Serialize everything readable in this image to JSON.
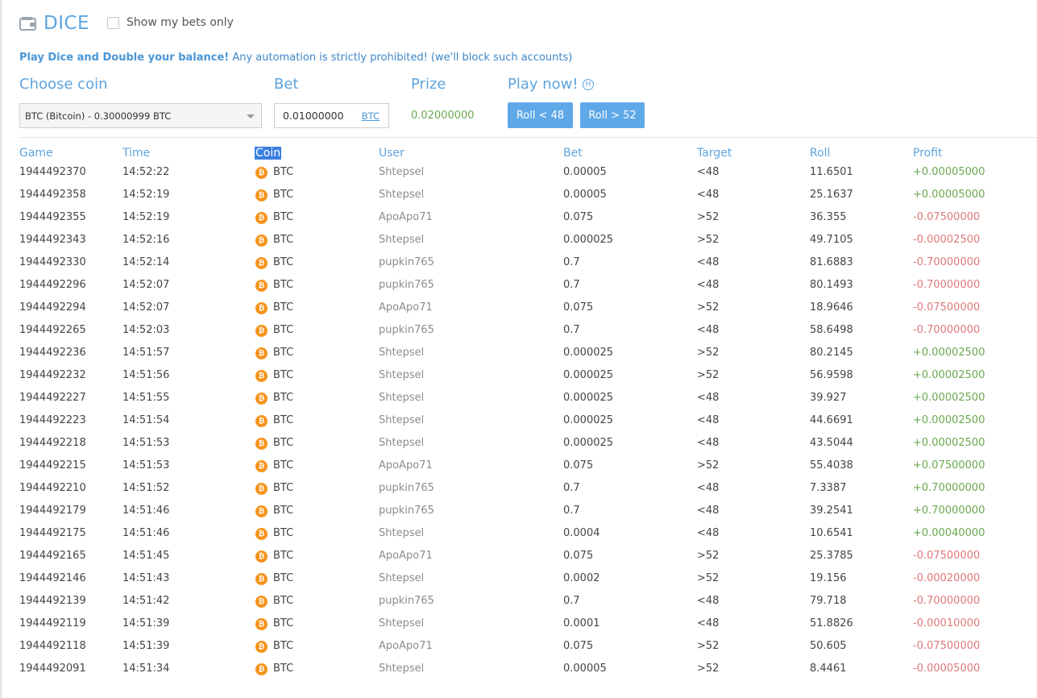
{
  "header": {
    "title": "DICE",
    "show_my_bets_label": "Show my bets only"
  },
  "promo": {
    "highlight": "Play Dice and Double your balance!",
    "rest": "Any automation is strictly prohibited! (we'll block such accounts)"
  },
  "controls": {
    "choose_coin_label": "Choose coin",
    "coin_selected": "BTC (Bitcoin) - 0.30000999 BTC",
    "bet_label": "Bet",
    "bet_value": "0.01000000",
    "bet_unit": "BTC",
    "prize_label": "Prize",
    "prize_value": "0.02000000",
    "play_label": "Play now!",
    "help_glyph": "H",
    "roll_low_label": "Roll < 48",
    "roll_high_label": "Roll > 52"
  },
  "colors": {
    "accent": "#5ea4de",
    "button": "#5fa8e8",
    "profit_positive": "#6aa84f",
    "profit_negative": "#e0787a",
    "coin": "#f7931a"
  },
  "table": {
    "columns": [
      "Game",
      "Time",
      "Coin",
      "User",
      "Bet",
      "Target",
      "Roll",
      "Profit"
    ],
    "rows": [
      {
        "game": "1944492370",
        "time": "14:52:22",
        "coin": "BTC",
        "user": "Shtepsel",
        "bet": "0.00005",
        "target": "<48",
        "roll": "11.6501",
        "profit": "+0.00005000"
      },
      {
        "game": "1944492358",
        "time": "14:52:19",
        "coin": "BTC",
        "user": "Shtepsel",
        "bet": "0.00005",
        "target": "<48",
        "roll": "25.1637",
        "profit": "+0.00005000"
      },
      {
        "game": "1944492355",
        "time": "14:52:19",
        "coin": "BTC",
        "user": "ApoApo71",
        "bet": "0.075",
        "target": ">52",
        "roll": "36.355",
        "profit": "-0.07500000"
      },
      {
        "game": "1944492343",
        "time": "14:52:16",
        "coin": "BTC",
        "user": "Shtepsel",
        "bet": "0.000025",
        "target": ">52",
        "roll": "49.7105",
        "profit": "-0.00002500"
      },
      {
        "game": "1944492330",
        "time": "14:52:14",
        "coin": "BTC",
        "user": "pupkin765",
        "bet": "0.7",
        "target": "<48",
        "roll": "81.6883",
        "profit": "-0.70000000"
      },
      {
        "game": "1944492296",
        "time": "14:52:07",
        "coin": "BTC",
        "user": "pupkin765",
        "bet": "0.7",
        "target": "<48",
        "roll": "80.1493",
        "profit": "-0.70000000"
      },
      {
        "game": "1944492294",
        "time": "14:52:07",
        "coin": "BTC",
        "user": "ApoApo71",
        "bet": "0.075",
        "target": ">52",
        "roll": "18.9646",
        "profit": "-0.07500000"
      },
      {
        "game": "1944492265",
        "time": "14:52:03",
        "coin": "BTC",
        "user": "pupkin765",
        "bet": "0.7",
        "target": "<48",
        "roll": "58.6498",
        "profit": "-0.70000000"
      },
      {
        "game": "1944492236",
        "time": "14:51:57",
        "coin": "BTC",
        "user": "Shtepsel",
        "bet": "0.000025",
        "target": ">52",
        "roll": "80.2145",
        "profit": "+0.00002500"
      },
      {
        "game": "1944492232",
        "time": "14:51:56",
        "coin": "BTC",
        "user": "Shtepsel",
        "bet": "0.000025",
        "target": ">52",
        "roll": "56.9598",
        "profit": "+0.00002500"
      },
      {
        "game": "1944492227",
        "time": "14:51:55",
        "coin": "BTC",
        "user": "Shtepsel",
        "bet": "0.000025",
        "target": "<48",
        "roll": "39.927",
        "profit": "+0.00002500"
      },
      {
        "game": "1944492223",
        "time": "14:51:54",
        "coin": "BTC",
        "user": "Shtepsel",
        "bet": "0.000025",
        "target": "<48",
        "roll": "44.6691",
        "profit": "+0.00002500"
      },
      {
        "game": "1944492218",
        "time": "14:51:53",
        "coin": "BTC",
        "user": "Shtepsel",
        "bet": "0.000025",
        "target": "<48",
        "roll": "43.5044",
        "profit": "+0.00002500"
      },
      {
        "game": "1944492215",
        "time": "14:51:53",
        "coin": "BTC",
        "user": "ApoApo71",
        "bet": "0.075",
        "target": ">52",
        "roll": "55.4038",
        "profit": "+0.07500000"
      },
      {
        "game": "1944492210",
        "time": "14:51:52",
        "coin": "BTC",
        "user": "pupkin765",
        "bet": "0.7",
        "target": "<48",
        "roll": "7.3387",
        "profit": "+0.70000000"
      },
      {
        "game": "1944492179",
        "time": "14:51:46",
        "coin": "BTC",
        "user": "pupkin765",
        "bet": "0.7",
        "target": "<48",
        "roll": "39.2541",
        "profit": "+0.70000000"
      },
      {
        "game": "1944492175",
        "time": "14:51:46",
        "coin": "BTC",
        "user": "Shtepsel",
        "bet": "0.0004",
        "target": "<48",
        "roll": "10.6541",
        "profit": "+0.00040000"
      },
      {
        "game": "1944492165",
        "time": "14:51:45",
        "coin": "BTC",
        "user": "ApoApo71",
        "bet": "0.075",
        "target": ">52",
        "roll": "25.3785",
        "profit": "-0.07500000"
      },
      {
        "game": "1944492146",
        "time": "14:51:43",
        "coin": "BTC",
        "user": "Shtepsel",
        "bet": "0.0002",
        "target": ">52",
        "roll": "19.156",
        "profit": "-0.00020000"
      },
      {
        "game": "1944492139",
        "time": "14:51:42",
        "coin": "BTC",
        "user": "pupkin765",
        "bet": "0.7",
        "target": "<48",
        "roll": "79.718",
        "profit": "-0.70000000"
      },
      {
        "game": "1944492119",
        "time": "14:51:39",
        "coin": "BTC",
        "user": "Shtepsel",
        "bet": "0.0001",
        "target": "<48",
        "roll": "51.8826",
        "profit": "-0.00010000"
      },
      {
        "game": "1944492118",
        "time": "14:51:39",
        "coin": "BTC",
        "user": "ApoApo71",
        "bet": "0.075",
        "target": ">52",
        "roll": "50.605",
        "profit": "-0.07500000"
      },
      {
        "game": "1944492091",
        "time": "14:51:34",
        "coin": "BTC",
        "user": "Shtepsel",
        "bet": "0.00005",
        "target": ">52",
        "roll": "8.4461",
        "profit": "-0.00005000"
      }
    ]
  }
}
